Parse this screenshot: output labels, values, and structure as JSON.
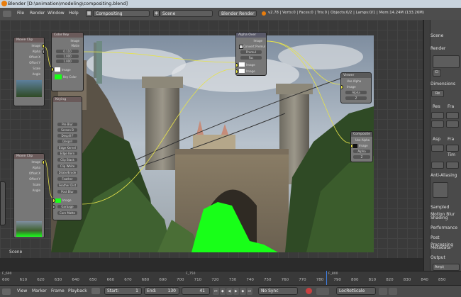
{
  "window": {
    "title": "Blender [D:\\animation\\modeling\\compositing.blend]"
  },
  "menubar": {
    "items": [
      "File",
      "Render",
      "Window",
      "Help"
    ],
    "screen_layout": "Compositing",
    "scene": "Scene",
    "render_engine": "Blender Render",
    "stats": "v2.78 | Verts:0 | Faces:0 | Tris:0 | Objects:0/2 | Lamps:0/1 | Mem:14.24M (133.26M)"
  },
  "editor": {
    "scene_label": "Scene",
    "nodes": {
      "movie_clip_1": {
        "header": "Movie Clip",
        "outputs": [
          "Image",
          "Alpha",
          "Offset X",
          "Offset Y",
          "Scale",
          "Angle"
        ]
      },
      "movie_clip_2": {
        "header": "Movie Clip",
        "outputs": [
          "Image",
          "Alpha",
          "Offset X",
          "Offset Y",
          "Scale",
          "Angle"
        ]
      },
      "color_key": {
        "header": "Color Key",
        "rows": [
          "Image",
          "Matte",
          "0.110",
          "1.000",
          "1.000",
          "Image",
          "Key Color"
        ]
      },
      "keying": {
        "header": "Keying",
        "rows": [
          "Pre Blur",
          "Screen B",
          "Despill F",
          "Despill",
          "Edge Kernel",
          "Edge Kern",
          "Clip Black",
          "Clip White",
          "Dilate/Erode",
          "Feather",
          "Feather Dist",
          "Post Blur",
          "Image",
          "Garbage",
          "Core Matte"
        ]
      },
      "alpha_over": {
        "header": "Alpha Over",
        "rows": [
          "Image",
          "Convert Premul",
          "Premul",
          "Fac",
          "Image",
          "Image"
        ]
      },
      "viewer": {
        "header": "Viewer",
        "rows": [
          "Use Alpha",
          "Image",
          "Alpha",
          "Z"
        ]
      },
      "composite": {
        "header": "Composite",
        "rows": [
          "Use Alpha",
          "Image",
          "Alpha",
          "Z"
        ]
      }
    }
  },
  "properties": {
    "tabs": [
      "Scene",
      "Render"
    ],
    "sections": [
      "Dimensions",
      "Anti-Aliasing",
      "Sampled Motion Blur",
      "Shading",
      "Performance",
      "Post Processing",
      "Metadata",
      "Output"
    ],
    "resolution_labels": [
      "Res",
      "Fra"
    ],
    "aspect_labels": [
      "Asp",
      "Fra"
    ],
    "time_label": "Tim",
    "render_btn": "Re",
    "output_field": "Amp\\"
  },
  "timeline": {
    "ticks": [
      "600",
      "610",
      "620",
      "630",
      "640",
      "650",
      "660",
      "670",
      "680",
      "690",
      "700",
      "710",
      "720",
      "730",
      "740",
      "750",
      "760",
      "770",
      "780",
      "790",
      "800",
      "810",
      "820",
      "830",
      "840",
      "850"
    ],
    "marker_left": "F_690",
    "marker_mid": "F_750",
    "marker_right": "F_800"
  },
  "status": {
    "menus": [
      "View",
      "Marker",
      "Frame",
      "Playback"
    ],
    "start_label": "Start:",
    "start_value": "1",
    "end_label": "End:",
    "end_value": "130",
    "current_frame": "41",
    "sync": "No Sync",
    "keying_set": "LocRotScale"
  },
  "colors": {
    "accent_orange": "#e87d0d",
    "green_screen": "#18ff18",
    "panel_bg": "#4a4a4a",
    "editor_bg": "#3a3a3a"
  }
}
